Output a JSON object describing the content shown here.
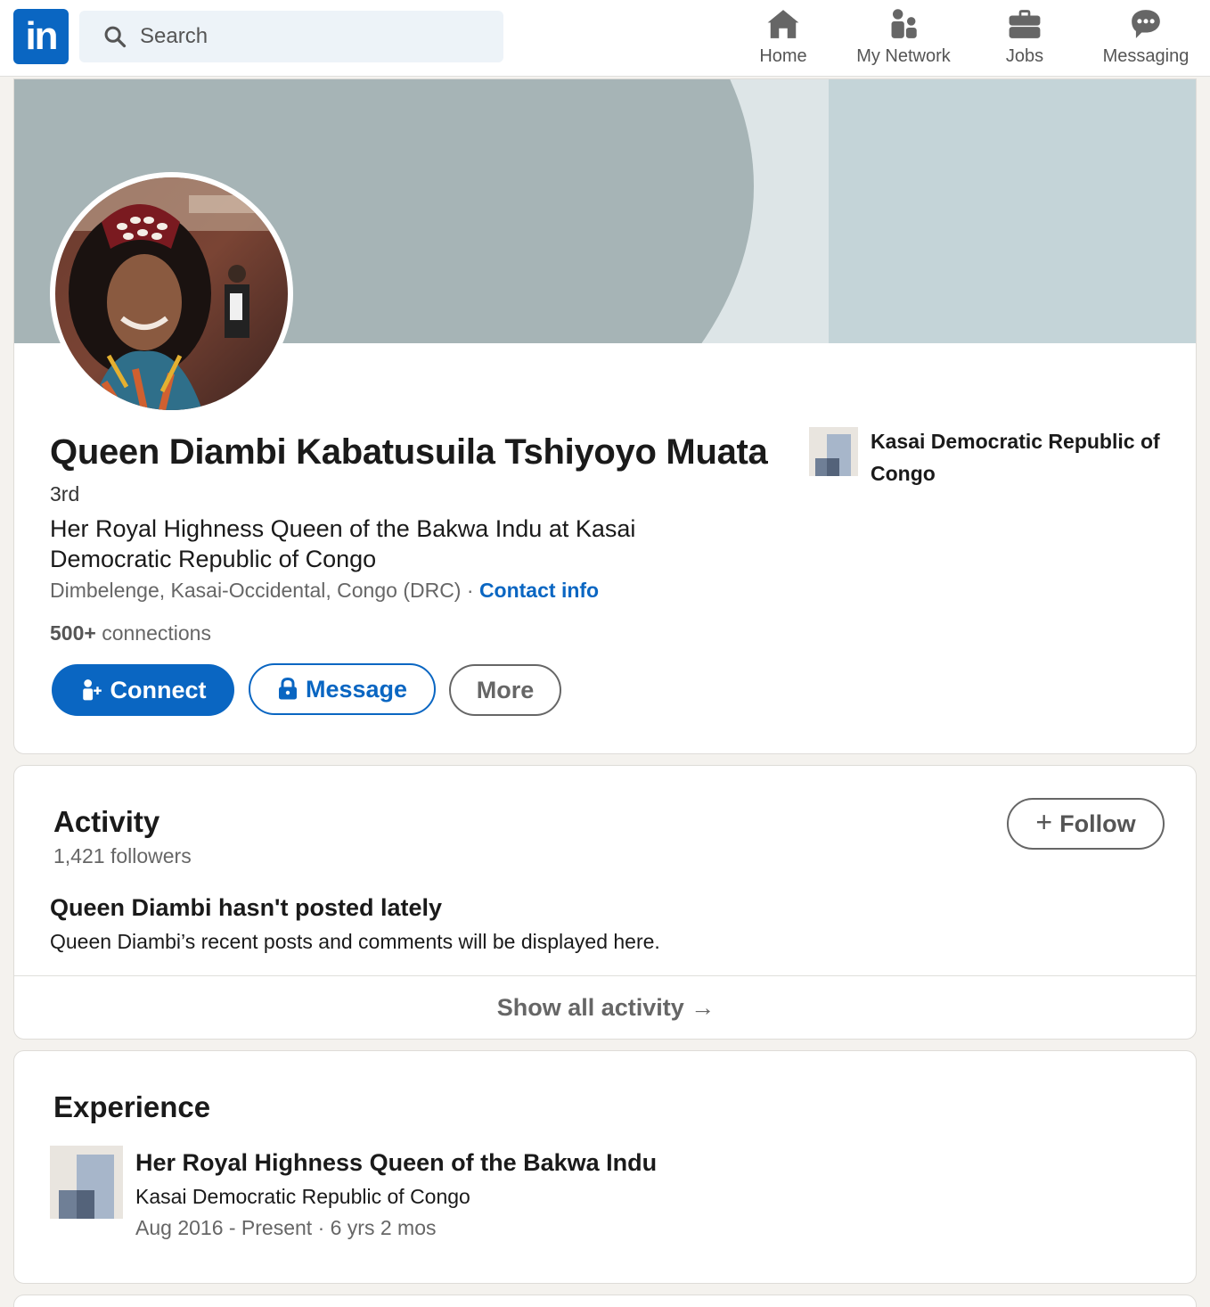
{
  "nav": {
    "logo_text": "in",
    "search_placeholder": "Search",
    "items": [
      {
        "label": "Home",
        "icon": "home-icon"
      },
      {
        "label": "My Network",
        "icon": "network-icon"
      },
      {
        "label": "Jobs",
        "icon": "briefcase-icon"
      },
      {
        "label": "Messaging",
        "icon": "messaging-icon"
      }
    ]
  },
  "profile": {
    "name": "Queen Diambi Kabatusuila Tshiyoyo Muata",
    "name_separator": "·",
    "degree": "3rd",
    "headline": "Her Royal Highness Queen of the Bakwa Indu at Kasai Democratic Republic of Congo",
    "location": "Dimbelenge, Kasai-Occidental, Congo (DRC)",
    "location_separator": " · ",
    "contact_info_label": "Contact info",
    "connections_count": "500+",
    "connections_label": " connections",
    "current_company": "Kasai Democratic Republic of Congo",
    "buttons": {
      "connect": "Connect",
      "message": "Message",
      "more": "More"
    }
  },
  "activity": {
    "title": "Activity",
    "followers": "1,421 followers",
    "follow_label": "Follow",
    "empty_title": "Queen Diambi hasn't posted lately",
    "empty_desc": "Queen Diambi’s recent posts and comments will be displayed here.",
    "show_all": "Show all activity →"
  },
  "experience": {
    "title": "Experience",
    "items": [
      {
        "role": "Her Royal Highness Queen of the Bakwa Indu",
        "company": "Kasai Democratic Republic of Congo",
        "dates": "Aug 2016 - Present · 6 yrs 2 mos"
      }
    ]
  },
  "colors": {
    "brand": "#0a66c2",
    "banner_dark": "#a6b4b6",
    "banner_light": "#c4d4d8"
  }
}
